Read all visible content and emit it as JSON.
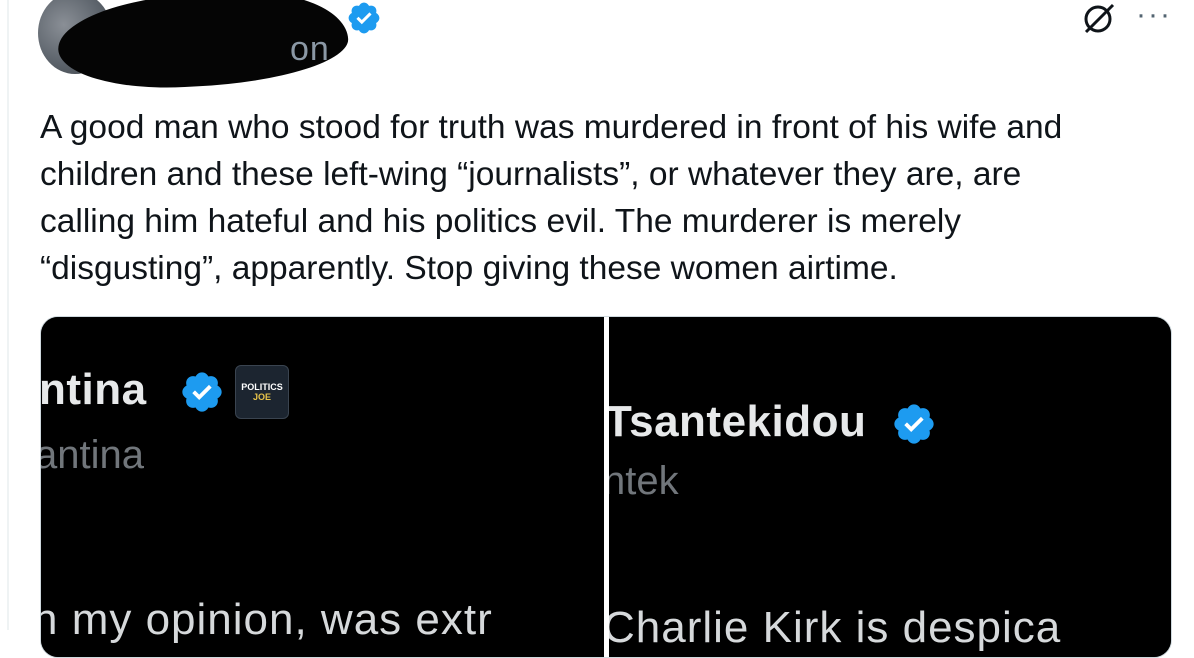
{
  "author": {
    "handle_fragment": "on",
    "verified_icon": "verified-check-icon"
  },
  "header_actions": {
    "grok_icon": "grok-icon",
    "more_label": "···"
  },
  "tweet": {
    "text": "A good man who stood for truth was murdered in front of his wife and\nchildren and these left-wing “journalists”, or whatever they are, are\ncalling him hateful and his politics evil. The murderer is merely\n“disgusting”, apparently. Stop giving these women airtime."
  },
  "media": {
    "left": {
      "name": "ntina",
      "handle": "antina",
      "body": "n my opinion, was extr",
      "affiliate_top": "POLITICS",
      "affiliate_bottom": "JOE"
    },
    "right": {
      "name": "Tsantekidou",
      "handle": "ntek",
      "body": "Charlie Kirk is despica"
    }
  },
  "colors": {
    "verified": "#1d9bf0",
    "text": "#0f1419",
    "muted": "#536471"
  }
}
